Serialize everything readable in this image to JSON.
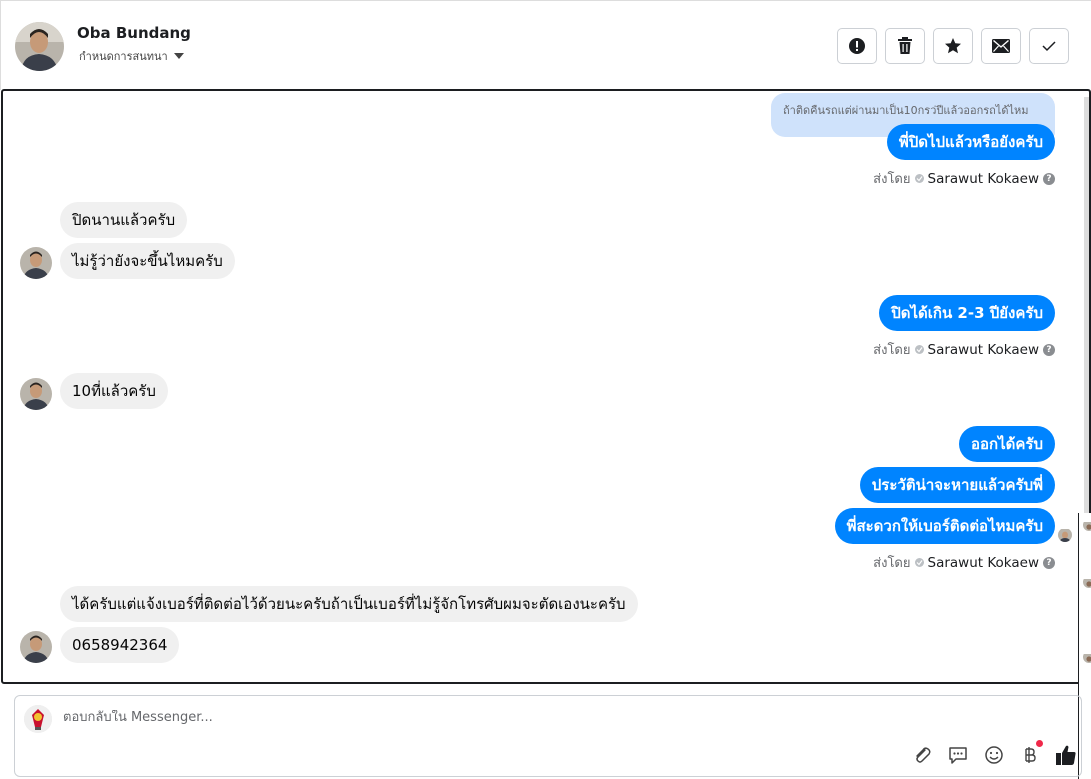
{
  "header": {
    "contact_name": "Oba Bundang",
    "conversation_setting": "กำหนดการสนทนา"
  },
  "toolbar": {
    "buttons": [
      {
        "name": "spam",
        "icon": "exclamation-icon"
      },
      {
        "name": "delete",
        "icon": "trash-icon"
      },
      {
        "name": "star",
        "icon": "star-icon"
      },
      {
        "name": "mark-unread",
        "icon": "envelope-icon"
      },
      {
        "name": "mark-done",
        "icon": "check-icon"
      }
    ]
  },
  "messages": {
    "quoted_reply": "ถ้าติดคืนรถแต่ผ่านมาเป็น10กรว่ปีแล้วออกรถได้ไหม",
    "out_1": "พี่ปิดไปแล้วหรือยังครับ",
    "in_1": "ปิดนานแล้วครับ",
    "in_2": "ไม่รู้ว่ายังจะขึ้นไหมครับ",
    "out_2": "ปิดได้เกิน 2-3 ปียังครับ",
    "in_3": "10ที่แล้วครับ",
    "out_3": "ออกได้ครับ",
    "out_4": "ประวัติน่าจะหายแล้วครับพี่",
    "out_5": "พี่สะดวกให้เบอร์ติดต่อไหมครับ",
    "in_4": "ได้ครับแต่แจ้งเบอร์ที่ติดต่อไว้ด้วยนะครับถ้าเป็นเบอร์ที่ไม่รู้จักโทรศับผมจะตัดเองนะครับ",
    "in_5": "0658942364"
  },
  "sent_by": {
    "label": "ส่งโดย",
    "agent": "Sarawut Kokaew",
    "help": "?"
  },
  "composer": {
    "placeholder": "ตอบกลับใน Messenger...",
    "tools": [
      "attach-icon",
      "saved-replies-icon",
      "emoji-icon",
      "baht-payment-icon",
      "thumbs-up-icon"
    ]
  },
  "colors": {
    "outgoing": "#0084ff",
    "incoming": "#f0f0f0",
    "quoted": "#cfe2fb",
    "notification": "#f02849"
  }
}
